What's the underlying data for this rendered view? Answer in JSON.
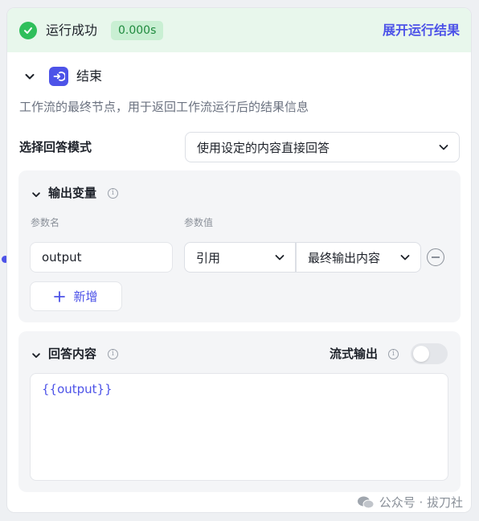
{
  "status": {
    "text": "运行成功",
    "time": "0.000s",
    "expand_label": "展开运行结果",
    "accent": "#4d53e8",
    "success_color": "#2fbf5b"
  },
  "node": {
    "title": "结束",
    "description": "工作流的最终节点，用于返回工作流运行后的结果信息",
    "icon": "end-node-icon"
  },
  "answer_mode": {
    "label": "选择回答模式",
    "selected": "使用设定的内容直接回答"
  },
  "output_vars": {
    "title": "输出变量",
    "col_name": "参数名",
    "col_value": "参数值",
    "rows": [
      {
        "name": "output",
        "type": "引用",
        "value": "最终输出内容"
      }
    ],
    "add_label": "新增"
  },
  "answer_content": {
    "title": "回答内容",
    "stream_label": "流式输出",
    "stream_enabled": false,
    "content": "{{output}}"
  },
  "watermark": "公众号 · 拔刀社"
}
